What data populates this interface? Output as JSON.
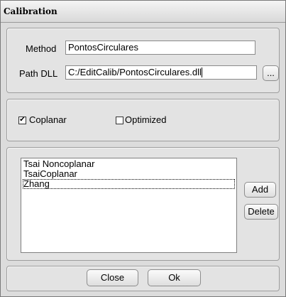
{
  "window": {
    "title": "Calibration"
  },
  "method": {
    "label": "Method",
    "value": "PontosCirculares"
  },
  "path_dll": {
    "label": "Path DLL",
    "value": "C:/EditCalib/PontosCirculares.dll",
    "browse_label": "..."
  },
  "options": {
    "coplanar": {
      "label": "Coplanar",
      "checked": true,
      "mark": "✔"
    },
    "optimized": {
      "label": "Optimized",
      "checked": false
    }
  },
  "methods_list": {
    "items": [
      "Tsai Noncoplanar",
      "TsaiCoplanar",
      "Zhang"
    ],
    "selected_index": 2
  },
  "buttons": {
    "add": "Add",
    "delete": "Delete",
    "close": "Close",
    "ok": "Ok"
  }
}
